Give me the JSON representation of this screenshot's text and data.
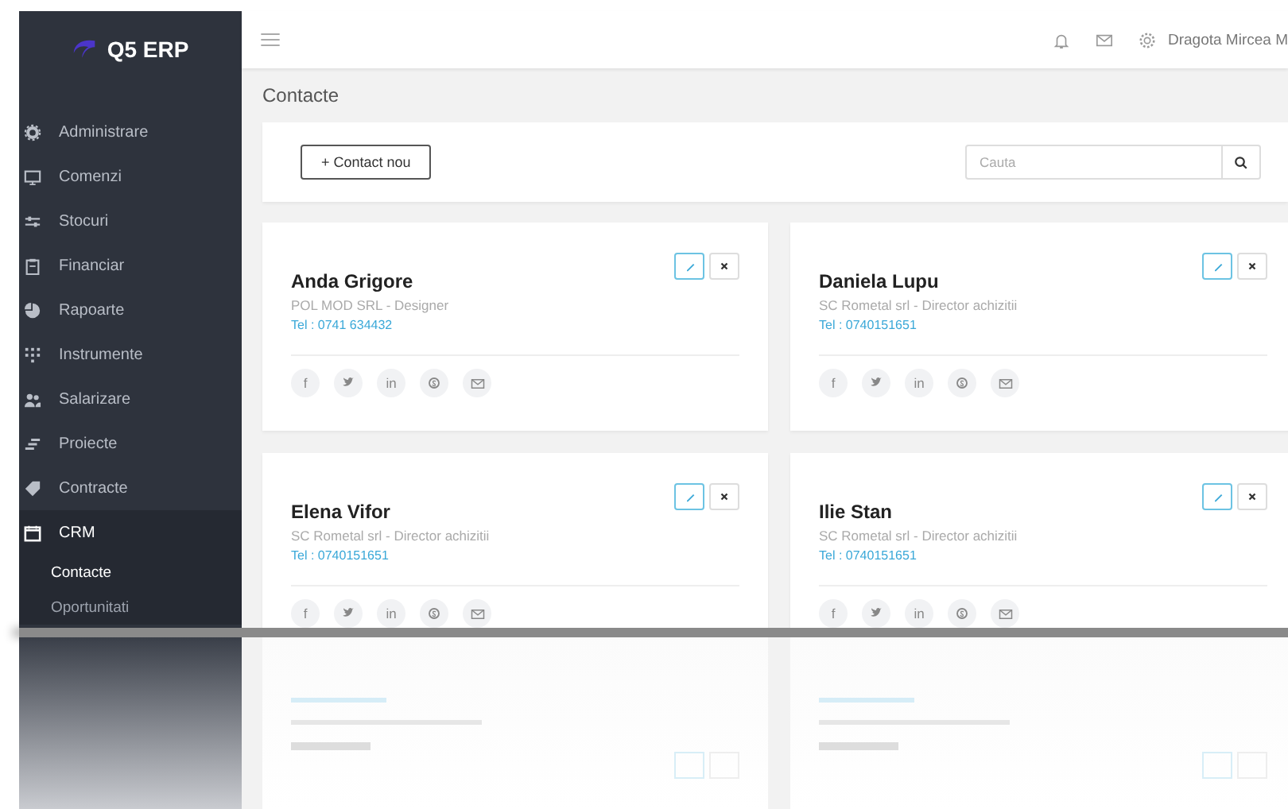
{
  "brand": {
    "name": "Q5 ERP"
  },
  "header": {
    "user": "Dragota Mircea M"
  },
  "sidebar": {
    "items": [
      {
        "label": "Administrare",
        "expanded": false
      },
      {
        "label": "Comenzi",
        "expanded": false
      },
      {
        "label": "Stocuri",
        "expanded": false
      },
      {
        "label": "Financiar",
        "expanded": false
      },
      {
        "label": "Rapoarte",
        "expanded": false
      },
      {
        "label": "Instrumente",
        "expanded": false
      },
      {
        "label": "Salarizare",
        "expanded": false
      },
      {
        "label": "Proiecte",
        "expanded": false
      },
      {
        "label": "Contracte",
        "expanded": false
      },
      {
        "label": "CRM",
        "expanded": true,
        "children": [
          {
            "label": "Contacte",
            "selected": true
          },
          {
            "label": "Oportunitati",
            "selected": false
          }
        ]
      }
    ]
  },
  "page": {
    "title": "Contacte"
  },
  "toolbar": {
    "add_button": "+ Contact nou",
    "search": {
      "placeholder": "Cauta"
    }
  },
  "contacts": [
    {
      "name": "Anda Grigore",
      "company": "POL MOD SRL - Designer",
      "phone": "Tel : 0741 634432",
      "social": [
        {
          "kind": "text",
          "label": "f"
        },
        {
          "kind": "bird"
        },
        {
          "kind": "text",
          "label": "in"
        },
        {
          "kind": "chat"
        },
        {
          "kind": "mail"
        }
      ]
    },
    {
      "name": "Daniela Lupu",
      "company": "SC Rometal srl - Director achizitii",
      "phone": "Tel : 0740151651",
      "social": [
        {
          "kind": "text",
          "label": "f"
        },
        {
          "kind": "bird"
        },
        {
          "kind": "text",
          "label": "in"
        },
        {
          "kind": "chat"
        },
        {
          "kind": "mail"
        }
      ]
    },
    {
      "name": "Elena Vifor",
      "company": "SC Rometal srl - Director achizitii",
      "phone": "Tel : 0740151651",
      "social": [
        {
          "kind": "text",
          "label": "f"
        },
        {
          "kind": "bird"
        },
        {
          "kind": "text",
          "label": "in"
        },
        {
          "kind": "chat"
        },
        {
          "kind": "mail"
        }
      ]
    },
    {
      "name": "Ilie Stan",
      "company": "SC Rometal srl - Director achizitii",
      "phone": "Tel : 0740151651",
      "social": [
        {
          "kind": "text",
          "label": "f"
        },
        {
          "kind": "bird"
        },
        {
          "kind": "text",
          "label": "in"
        },
        {
          "kind": "chat"
        },
        {
          "kind": "mail"
        }
      ]
    }
  ]
}
